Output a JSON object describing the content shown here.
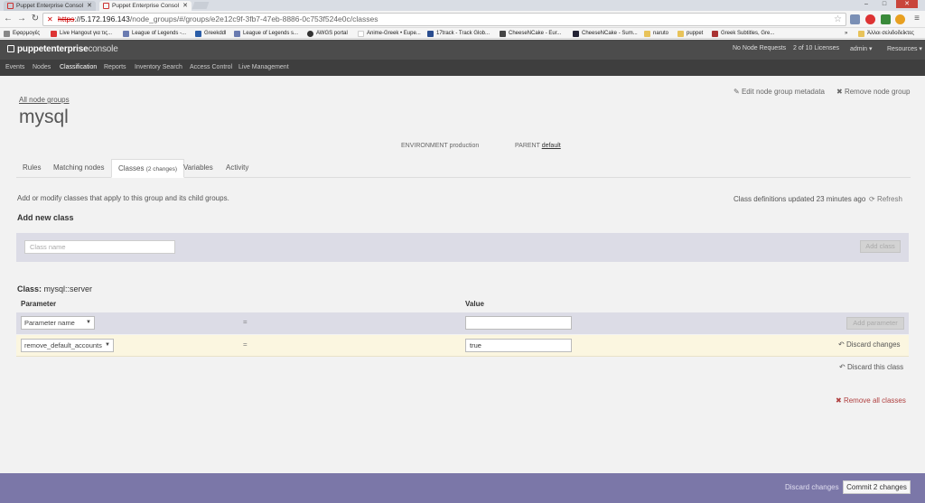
{
  "browser": {
    "tabs": [
      {
        "title": "Puppet Enterprise Consol"
      },
      {
        "title": "Puppet Enterprise Consol"
      }
    ],
    "url_scheme": "https",
    "url_host": "://5.172.196.143",
    "url_path": "/node_groups/#/groups/e2e12c9f-3fb7-47eb-8886-0c753f524e0c/classes",
    "bookmarks": [
      "Εφαρμογές",
      "Live Hangout για τις...",
      "League of Legends -...",
      "Greekddl",
      "League of Legends s...",
      "AWGS portal",
      "Anime-Greek • Eupe...",
      "17track - Track Glob...",
      "CheeseNCake - Eur...",
      "CheeseNCake - Sum...",
      "naruto",
      "puppet",
      "Greek Subtitles, Gre...",
      "»",
      "Άλλοι σελιδοδείκτες"
    ]
  },
  "header": {
    "logo_main": "puppetenterprise",
    "logo_sub": "console",
    "node_requests": "No Node Requests",
    "licenses": "2 of 10 Licenses",
    "user": "admin ▾",
    "resources": "Resources ▾"
  },
  "nav": [
    "Events",
    "Nodes",
    "Classification",
    "Reports",
    "Inventory Search",
    "Access Control",
    "Live Management"
  ],
  "group": {
    "breadcrumb": "All node groups",
    "name": "mysql",
    "edit_metadata": "Edit node group metadata",
    "remove_group": "Remove node group",
    "env_label": "ENVIRONMENT",
    "env_value": "production",
    "parent_label": "PARENT",
    "parent_value": "default"
  },
  "tabs": {
    "rules": "Rules",
    "matching": "Matching nodes",
    "classes": "Classes",
    "classes_badge": "(2 changes)",
    "variables": "Variables",
    "activity": "Activity"
  },
  "classes_panel": {
    "intro": "Add or modify classes that apply to this group and its child groups.",
    "updated": "Class definitions updated 23 minutes ago",
    "refresh": "Refresh",
    "add_new_title": "Add new class",
    "class_name_placeholder": "Class name",
    "add_class_button": "Add class"
  },
  "class_block": {
    "label": "Class:",
    "name": "mysql::server",
    "col_parameter": "Parameter",
    "col_value": "Value",
    "new_param_placeholder": "Parameter name",
    "equals": "=",
    "add_parameter_button": "Add parameter",
    "param_name": "remove_default_accounts",
    "param_value": "true",
    "discard_changes": "Discard changes",
    "discard_class": "Discard this class",
    "remove_all": "Remove all classes"
  },
  "footer": {
    "discard": "Discard changes",
    "commit": "Commit 2 changes"
  },
  "colors": {
    "header_bg": "#4c4c4c",
    "nav_bg": "#3e3e3e",
    "footer_bg": "#7b77a8",
    "changed_row_bg": "#fbf6e0",
    "remove_red": "#b04040"
  }
}
